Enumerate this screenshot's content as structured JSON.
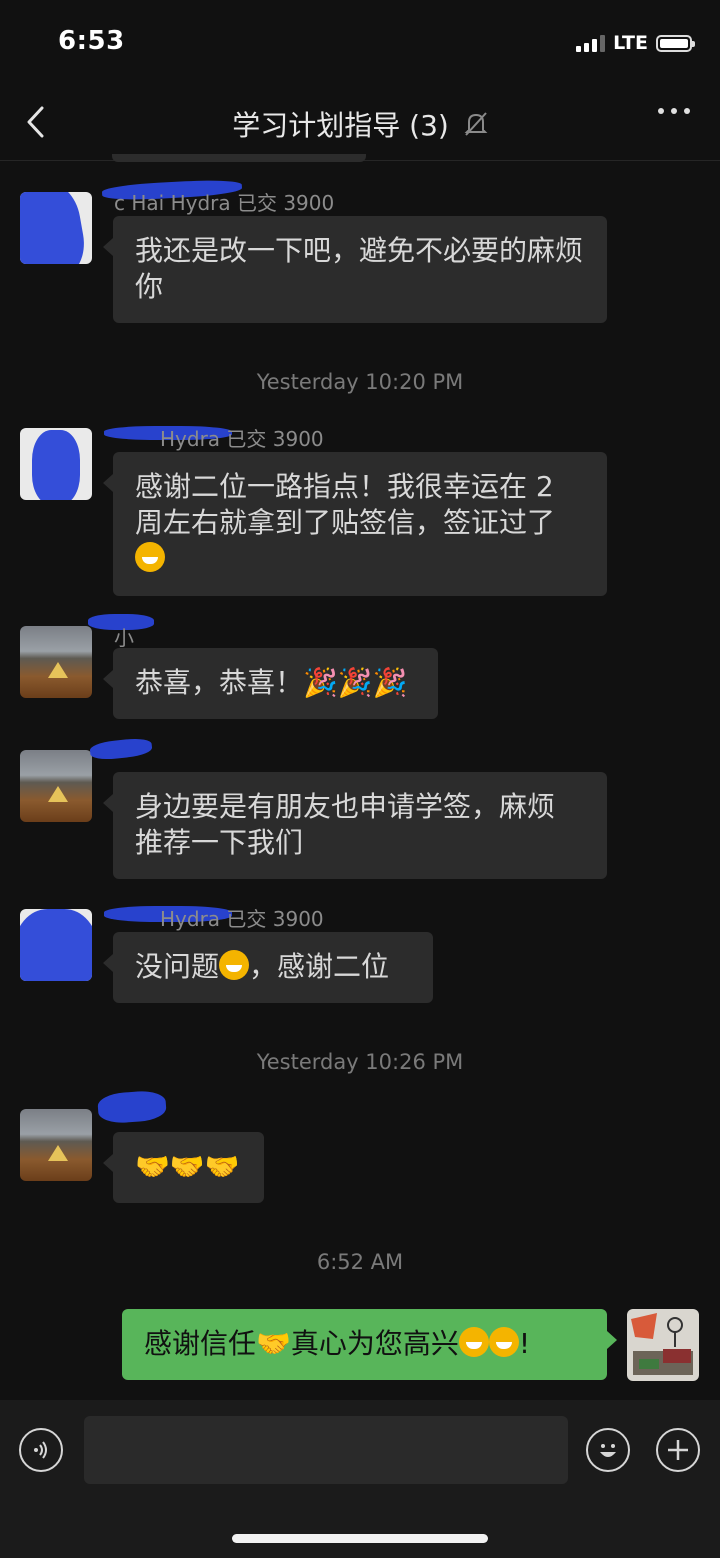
{
  "status_bar": {
    "time": "6:53",
    "network": "LTE"
  },
  "header": {
    "title": "学习计划指导 (3)"
  },
  "messages": [
    {
      "sender": "c Hai Hydra 已交 3900",
      "text": "我还是改一下吧，避免不必要的麻烦你"
    },
    {
      "timestamp": "Yesterday 10:20 PM"
    },
    {
      "sender": "Hydra 已交 3900",
      "text_line1": "感谢二位一路指点！我很幸运在 2",
      "text_line2": "周左右就拿到了贴签信，签证过了"
    },
    {
      "sender": "小",
      "text": "恭喜，恭喜！"
    },
    {
      "sender": "",
      "text_line1": "身边要是有朋友也申请学签，麻烦",
      "text_line2": "推荐一下我们"
    },
    {
      "sender": "Hydra 已交 3900",
      "text_a": "没问题",
      "text_b": "，感谢二位"
    },
    {
      "timestamp": "Yesterday 10:26 PM"
    },
    {
      "sender": "",
      "text": ""
    },
    {
      "timestamp": "6:52 AM"
    },
    {
      "text_a": "感谢信任",
      "text_b": "真心为您高兴",
      "text_c": "!"
    }
  ],
  "icons": [
    "back-chevron-icon",
    "mute-bell-icon",
    "more-dots-icon",
    "voice-icon",
    "emoji-icon",
    "plus-icon",
    "grin-emoji-icon",
    "party-popper-icon",
    "handshake-icon",
    "smile-emoji-icon"
  ],
  "colors": {
    "background": "#111111",
    "bubble_other": "#2c2c2c",
    "bubble_me": "#58b55a",
    "scribble": "#2a46d8"
  }
}
